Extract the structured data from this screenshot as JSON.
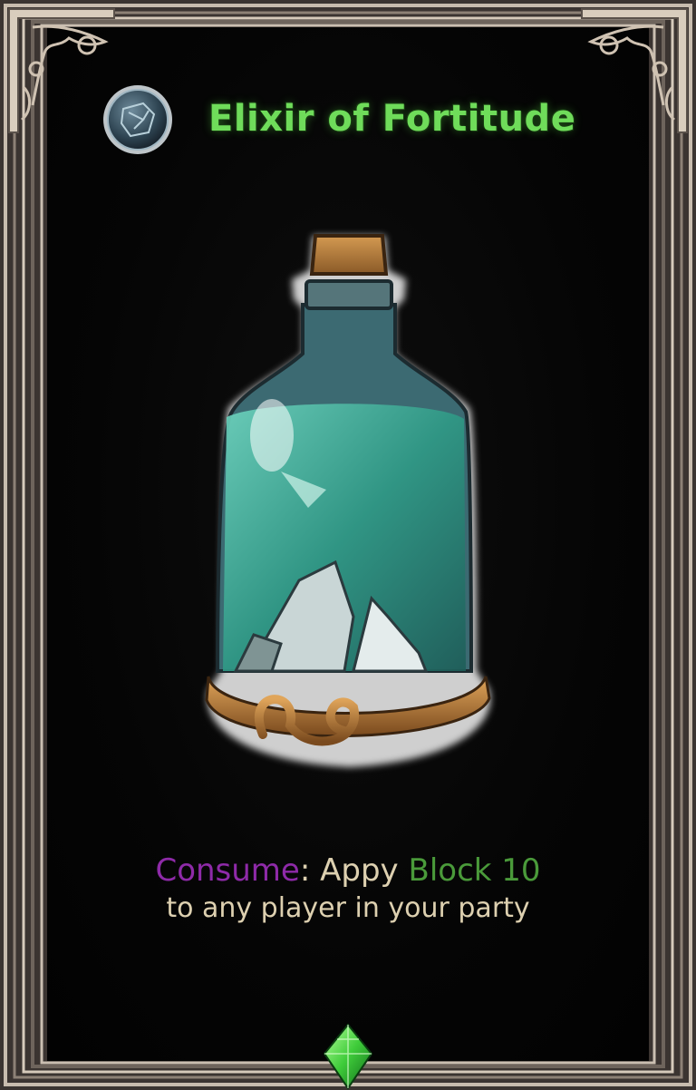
{
  "card": {
    "title": "Elixir of Fortitude",
    "medallion_icon": "shield-rune-icon",
    "gem_icon": "green-crystal-icon",
    "description": {
      "consume_keyword": "Consume",
      "colon": ":",
      "action": " Appy ",
      "effect_keyword": "Block 10",
      "line2": "to any player in your party"
    }
  },
  "colors": {
    "title": "#6fdc5a",
    "consume": "#8e2aa8",
    "block": "#4a9a3a",
    "text": "#ddd0b0",
    "frame": "#b8a99a",
    "background": "#050505",
    "liquid": "#3fb39a",
    "cork": "#b07a3a"
  }
}
